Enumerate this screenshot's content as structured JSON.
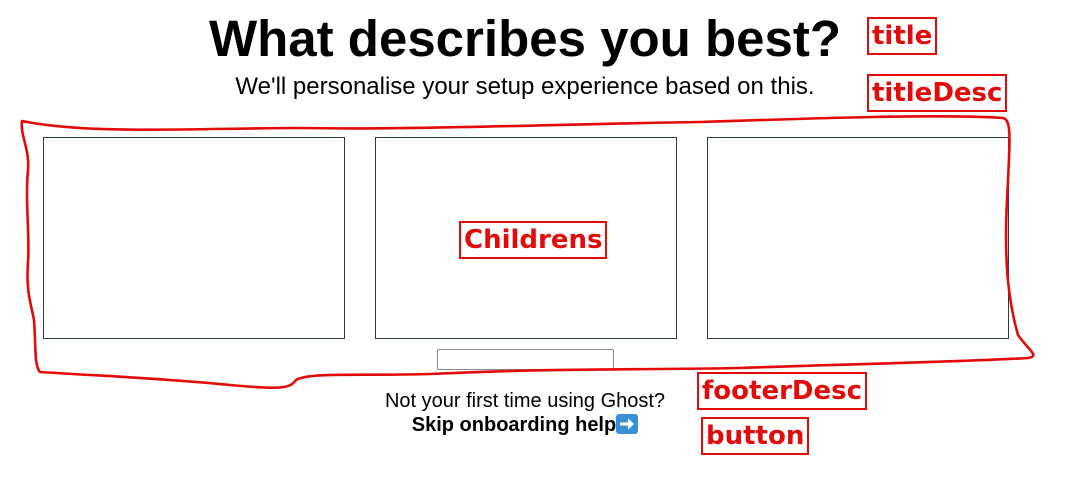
{
  "header": {
    "title": "What describes you best?",
    "description": "We'll personalise your setup experience based on this."
  },
  "footer": {
    "description": "Not your first time using Ghost?",
    "skip_label": "Skip onboarding help",
    "skip_icon": "right-arrow-icon"
  },
  "annotations": {
    "color": "#e30a0a",
    "title": "title",
    "title_desc": "titleDesc",
    "childrens": "Childrens",
    "footer_desc": "footerDesc",
    "button": "button"
  }
}
